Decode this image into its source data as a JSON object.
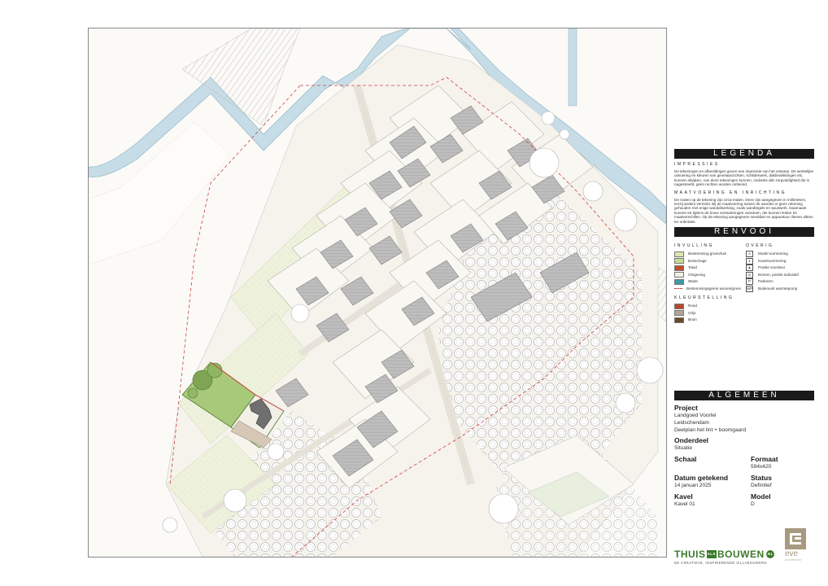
{
  "map": {
    "description_icon": "site-plan"
  },
  "legend": {
    "title": "LEGENDA",
    "impressies_title": "IMPRESSIES",
    "impressies_text": "De tekeningen en afbeeldingen geven een impressie van het ontwerp. De werkelijke uitvoering en kleuren van gevelaanzichten, schilderwerk, dakbedekkingen etc. kunnen afwijken. Aan deze tekeningen kunnen, ondanks alle zorgvuldigheid die is nagestreefd, géén rechten worden ontleend.",
    "maatvoering_title": "MAATVOERING EN INRICHTING",
    "maatvoering_text": "De maten op de tekening zijn circa-maten. Deze zijn aangegeven in millimeters, tenzij anders vermeld. Bij de maatvoering tussen de wanden is geen rekening gehouden met enige wandafwerking, zoals wandtegels en spuitwerk. Daarnaast kunnen tot tijdens de bouw veranderingen voordoen, die kunnen leiden tot maatverschillen. Op de tekening aangegeven meubilair en apparatuur dienen alleen ter oriëntatie."
  },
  "renvooi": {
    "title": "RENVOOI",
    "invulling_title": "INVULLING",
    "invulling": [
      {
        "label": "Bestemming groen/tuin",
        "color": "#d9e8b0"
      },
      {
        "label": "Bosschage",
        "color": "#c4dd97"
      },
      {
        "label": "Talud",
        "color": "#c0502a"
      },
      {
        "label": "Omgeving",
        "color": "#f0f0e4"
      },
      {
        "label": "Water",
        "color": "#3a9aa6"
      },
      {
        "label": "Bestemmingsgrens wonen/groen",
        "color": "#d04040"
      }
    ],
    "overig_title": "OVERIG",
    "overig": [
      {
        "label": "Model nummering",
        "symbol": "A"
      },
      {
        "label": "Kavelnummering",
        "symbol": "1"
      },
      {
        "label": "Positie voordeur",
        "symbol": "▲"
      },
      {
        "label": "Bomen, positie indicatief",
        "symbol": "◎"
      },
      {
        "label": "Parkeren",
        "symbol": "P"
      },
      {
        "label": "Buitenunit warmtepomp",
        "symbol": "WP"
      }
    ],
    "kleur_title": "KLEURSTELLING",
    "kleur": [
      {
        "label": "Rood",
        "color": "#b5482e"
      },
      {
        "label": "Grijs",
        "color": "#b3a59a"
      },
      {
        "label": "Bruin",
        "color": "#6b4a2a"
      }
    ]
  },
  "algemeen": {
    "title": "ALGEMEEN",
    "project_label": "Project",
    "project_lines": [
      "Landgoed Voorlei",
      "Leidschendam",
      "Deelplan het lint + boomgaard"
    ],
    "onderdeel_label": "Onderdeel",
    "onderdeel_value": "Situatie",
    "schaal_label": "Schaal",
    "formaat_label": "Formaat",
    "formaat_value": "594x420",
    "datum_label": "Datum getekend",
    "datum_value": "14 januari 2025",
    "status_label": "Status",
    "status_value": "Definitief",
    "kavel_label": "Kavel",
    "kavel_value": "Kavel 01",
    "model_label": "Model",
    "model_value": "D"
  },
  "brand": {
    "name_a": "THUIS",
    "name_mid": "ALS",
    "name_b": "BOUWEN",
    "nl": ".NL",
    "tagline": "DE CREATIEVE, INSPIRERENDE VILLABOUWERS",
    "eve_word": "eve",
    "eve_sub": "architecten",
    "brand_color": "#3b7a2a",
    "eve_color": "#a89a80"
  }
}
